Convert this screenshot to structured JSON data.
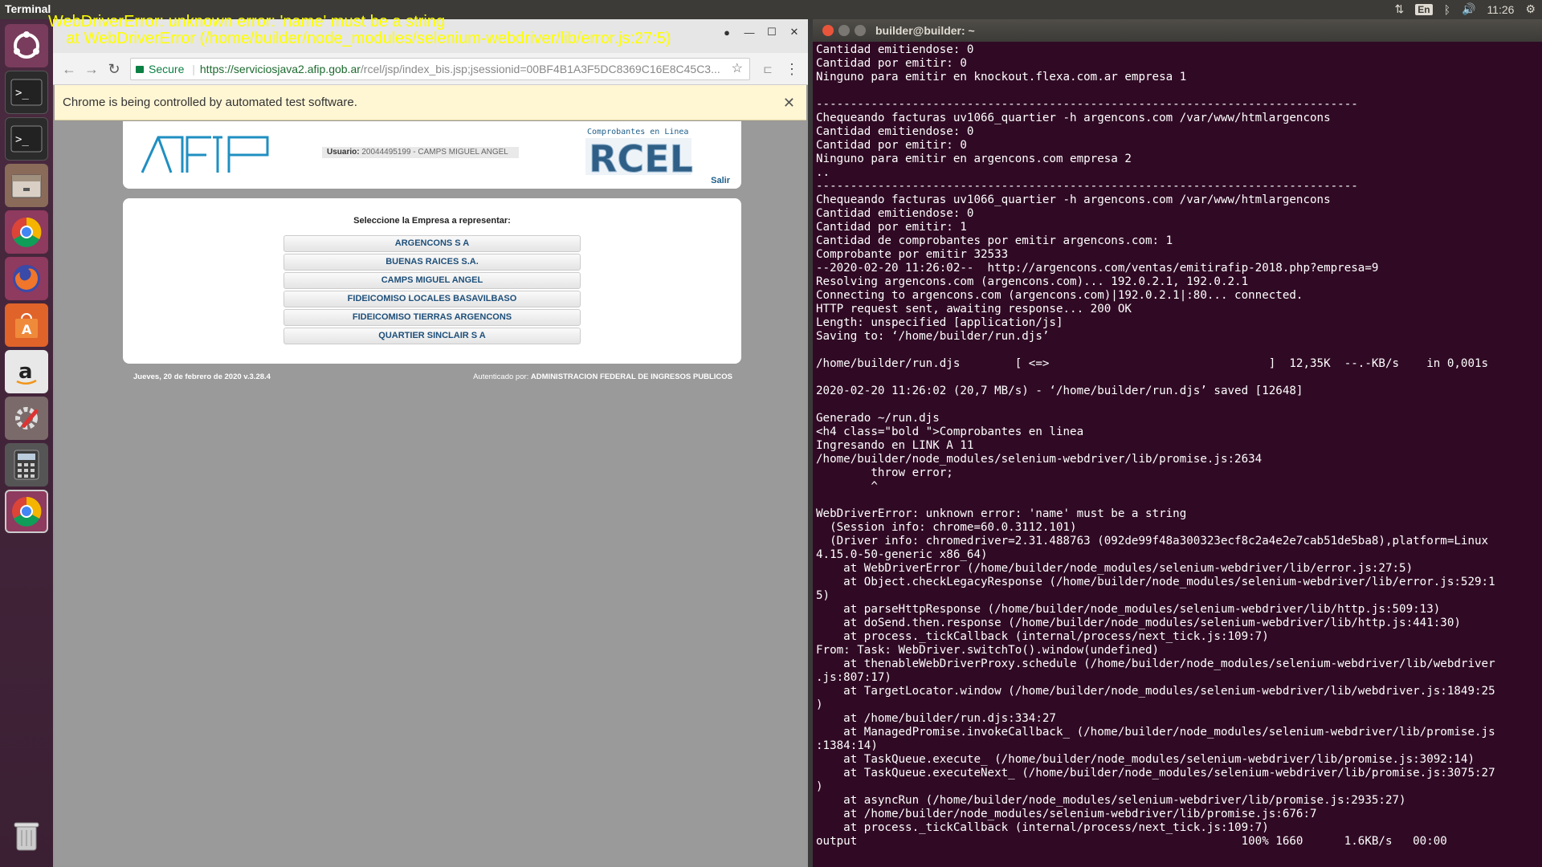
{
  "topbar": {
    "app_name": "Terminal",
    "lang": "En",
    "clock": "11:26"
  },
  "overlay": {
    "line1": "WebDriverError: unknown error: 'name' must be a string",
    "line2": "    at WebDriverError (/home/builder/node_modules/selenium-webdriver/lib/error.js:27:5)"
  },
  "launcher": {
    "items": [
      "dash-icon",
      "terminal-icon",
      "terminal-icon",
      "files-icon",
      "chrome-icon",
      "firefox-icon",
      "software-center-icon",
      "amazon-icon",
      "settings-icon",
      "calculator-icon",
      "chrome-icon",
      "trash-icon"
    ]
  },
  "chrome": {
    "url_secure": "Secure",
    "url_scheme": "https://",
    "url_host": "serviciosjava2.afip.gob.ar",
    "url_path": "/rcel/jsp/index_bis.jsp;jsessionid=00BF4B1A3F5DC8369C16E8C45C3...",
    "infobar_text": "Chrome is being controlled by automated test software.",
    "page": {
      "logo_text": "AFIP",
      "usuario_label": "Usuario:",
      "usuario_value": "20044495199 - CAMPS MIGUEL ANGEL",
      "rcel_tagline": "Comprobantes en Linea",
      "rcel_logo": "RCEL",
      "salir": "Salir",
      "select_title": "Seleccione la Empresa a representar:",
      "empresas": [
        "ARGENCONS S A",
        "BUENAS RAICES S.A.",
        "CAMPS MIGUEL ANGEL",
        "FIDEICOMISO LOCALES BASAVILBASO",
        "FIDEICOMISO TIERRAS ARGENCONS",
        "QUARTIER SINCLAIR S A"
      ],
      "footer_left": "Jueves, 20 de febrero de 2020 v.3.28.4",
      "footer_right_label": "Autenticado por:",
      "footer_right_value": "ADMINISTRACION FEDERAL DE INGRESOS PUBLICOS"
    }
  },
  "terminal": {
    "title": "builder@builder: ~",
    "lines": [
      "Cantidad emitiendose: 0",
      "Cantidad por emitir: 0",
      "Ninguno para emitir en knockout.flexa.com.ar empresa 1",
      "",
      "-------------------------------------------------------------------------------",
      "Chequeando facturas uv1066_quartier -h argencons.com /var/www/htmlargencons",
      "Cantidad emitiendose: 0",
      "Cantidad por emitir: 0",
      "Ninguno para emitir en argencons.com empresa 2",
      "..",
      "-------------------------------------------------------------------------------",
      "Chequeando facturas uv1066_quartier -h argencons.com /var/www/htmlargencons",
      "Cantidad emitiendose: 0",
      "Cantidad por emitir: 1",
      "Cantidad de comprobantes por emitir argencons.com: 1",
      "Comprobante por emitir 32533",
      "--2020-02-20 11:26:02--  http://argencons.com/ventas/emitirafip-2018.php?empresa=9",
      "Resolving argencons.com (argencons.com)... 192.0.2.1, 192.0.2.1",
      "Connecting to argencons.com (argencons.com)|192.0.2.1|:80... connected.",
      "HTTP request sent, awaiting response... 200 OK",
      "Length: unspecified [application/js]",
      "Saving to: ‘/home/builder/run.djs’",
      "",
      "/home/builder/run.djs        [ <=>                                ]  12,35K  --.-KB/s    in 0,001s",
      "",
      "2020-02-20 11:26:02 (20,7 MB/s) - ‘/home/builder/run.djs’ saved [12648]",
      "",
      "Generado ~/run.djs",
      "<h4 class=\"bold \">Comprobantes en linea",
      "Ingresando en LINK A 11",
      "/home/builder/node_modules/selenium-webdriver/lib/promise.js:2634",
      "        throw error;",
      "        ^",
      "",
      "WebDriverError: unknown error: 'name' must be a string",
      "  (Session info: chrome=60.0.3112.101)",
      "  (Driver info: chromedriver=2.31.488763 (092de99f48a300323ecf8c2a4e2e7cab51de5ba8),platform=Linux",
      "4.15.0-50-generic x86_64)",
      "    at WebDriverError (/home/builder/node_modules/selenium-webdriver/lib/error.js:27:5)",
      "    at Object.checkLegacyResponse (/home/builder/node_modules/selenium-webdriver/lib/error.js:529:1",
      "5)",
      "    at parseHttpResponse (/home/builder/node_modules/selenium-webdriver/lib/http.js:509:13)",
      "    at doSend.then.response (/home/builder/node_modules/selenium-webdriver/lib/http.js:441:30)",
      "    at process._tickCallback (internal/process/next_tick.js:109:7)",
      "From: Task: WebDriver.switchTo().window(undefined)",
      "    at thenableWebDriverProxy.schedule (/home/builder/node_modules/selenium-webdriver/lib/webdriver",
      ".js:807:17)",
      "    at TargetLocator.window (/home/builder/node_modules/selenium-webdriver/lib/webdriver.js:1849:25",
      ")",
      "    at /home/builder/run.djs:334:27",
      "    at ManagedPromise.invokeCallback_ (/home/builder/node_modules/selenium-webdriver/lib/promise.js",
      ":1384:14)",
      "    at TaskQueue.execute_ (/home/builder/node_modules/selenium-webdriver/lib/promise.js:3092:14)",
      "    at TaskQueue.executeNext_ (/home/builder/node_modules/selenium-webdriver/lib/promise.js:3075:27",
      ")",
      "    at asyncRun (/home/builder/node_modules/selenium-webdriver/lib/promise.js:2935:27)",
      "    at /home/builder/node_modules/selenium-webdriver/lib/promise.js:676:7",
      "    at process._tickCallback (internal/process/next_tick.js:109:7)",
      "output                                                        100% 1660      1.6KB/s   00:00"
    ]
  }
}
